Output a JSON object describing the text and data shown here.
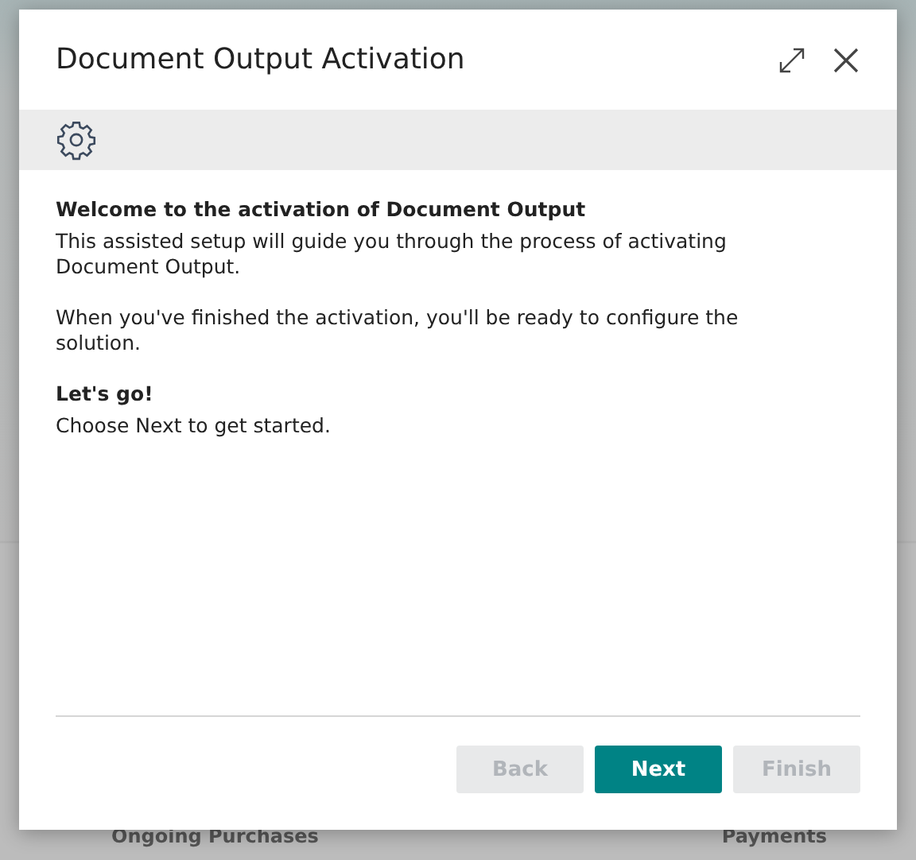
{
  "background": {
    "labels": [
      "Ongoing Purchases",
      "Payments"
    ]
  },
  "dialog": {
    "title": "Document Output Activation",
    "heading": "Welcome to the activation of Document Output",
    "paragraphs": [
      "This assisted setup will guide you through the process of activating Document Output.",
      "When you've finished the activation, you'll be ready to configure the solution."
    ],
    "subheading": "Let's go!",
    "instruction": "Choose Next to get started.",
    "buttons": [
      {
        "label": "Back",
        "disabled": true
      },
      {
        "label": "Next",
        "disabled": false
      },
      {
        "label": "Finish",
        "disabled": true
      }
    ]
  }
}
